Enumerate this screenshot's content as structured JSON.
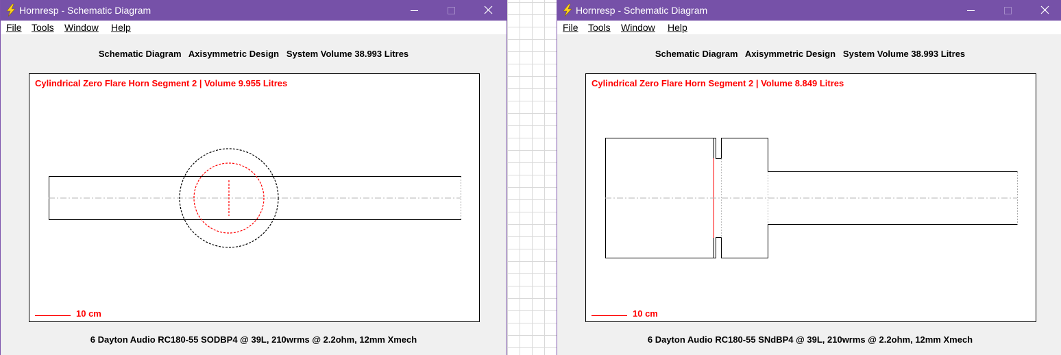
{
  "windows": [
    {
      "title": "Hornresp - Schematic Diagram",
      "menu": [
        "File",
        "Tools",
        "Window",
        "Help"
      ],
      "header": "Schematic Diagram   Axisymmetric Design   System Volume 38.993 Litres",
      "segment_label": "Cylindrical Zero Flare Horn Segment 2 | Volume 9.955 Litres",
      "scale_label": "10 cm",
      "footer": "6 Dayton Audio RC180-55 SODBP4 @ 39L, 210wrms @ 2.2ohm, 12mm Xmech"
    },
    {
      "title": "Hornresp - Schematic Diagram",
      "menu": [
        "File",
        "Tools",
        "Window",
        "Help"
      ],
      "header": "Schematic Diagram   Axisymmetric Design   System Volume 38.993 Litres",
      "segment_label": "Cylindrical Zero Flare Horn Segment 2 | Volume 8.849 Litres",
      "scale_label": "10 cm",
      "footer": "6 Dayton Audio RC180-55 SNdBP4 @ 39L, 210wrms @ 2.2ohm, 12mm Xmech"
    }
  ],
  "icons": {
    "app": "lightning-bolt-icon",
    "minimize": "minimize-icon",
    "maximize": "maximize-icon",
    "close": "close-icon"
  },
  "colors": {
    "titlebar": "#7651a8",
    "accent_red": "#ff0000",
    "window_bg": "#f0f0f0"
  }
}
